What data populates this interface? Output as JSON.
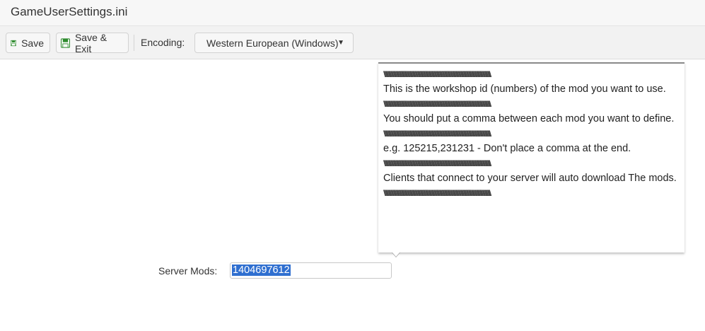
{
  "window": {
    "title": "GameUserSettings.ini"
  },
  "toolbar": {
    "save_label": "Save",
    "save_exit_label": "Save & Exit",
    "encoding_label": "Encoding:",
    "encoding_value": "Western European (Windows)",
    "save_icon": "floppy-disk-icon",
    "accent_color": "#2e8b2e"
  },
  "tooltip": {
    "separator": "\\\\\\\\\\\\\\\\\\\\\\\\\\\\\\\\\\\\\\\\\\\\\\\\\\\\\\\\\\\\\\\\\\\\\\\\\\\\\\\\\\\\\\\\\\\\\\\\\\\\\\\\\\\\\\\\\\\\\\\\\\\\\\\\\\\\\\\\\\\\\\\\\\\\\\\\\\\\\\\\\\\\\\\\\\\\\\\\\\\\\\\\\\\\\\\\\\\\\\\\\\\\\\\\\\\\\\\\\\\\\\\\\\\\\\\\\\\\\\\\\\\\\\\\\\\\\\\\\\\\\\\\\\\\\\\\\\\\\\\\\\\\\\\\\\\\",
    "lines": [
      "This is the workshop id (numbers) of the mod you want to use.",
      "You should put a comma between each mod you want to define.",
      "e.g. 125215,231231 - Don't place a comma at the end.",
      "Clients that connect to your server will auto download The mods."
    ]
  },
  "form": {
    "server_mods_label": "Server Mods:",
    "server_mods_value": "1404697612",
    "selection_color": "#2f6fd0"
  }
}
